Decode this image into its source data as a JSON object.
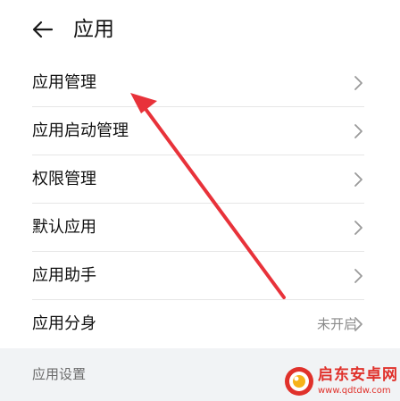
{
  "header": {
    "title": "应用",
    "back_icon": "back-arrow-icon"
  },
  "list": {
    "items": [
      {
        "label": "应用管理",
        "value": ""
      },
      {
        "label": "应用启动管理",
        "value": ""
      },
      {
        "label": "权限管理",
        "value": ""
      },
      {
        "label": "默认应用",
        "value": ""
      },
      {
        "label": "应用助手",
        "value": ""
      },
      {
        "label": "应用分身",
        "value": "未开启"
      }
    ]
  },
  "section": {
    "title": "应用设置"
  },
  "watermark": {
    "title": "启东安卓网",
    "url": "www.qdtdw.com"
  },
  "colors": {
    "annotation_arrow": "#e8323a",
    "background": "#f1f3f5",
    "card": "#ffffff",
    "watermark": "#e0312b"
  }
}
